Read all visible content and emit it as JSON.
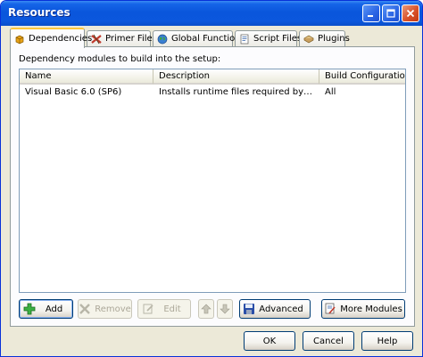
{
  "window": {
    "title": "Resources"
  },
  "tabs": [
    {
      "label": "Dependencies",
      "icon": "dependencies-icon",
      "active": true
    },
    {
      "label": "Primer Files",
      "icon": "primer-files-icon",
      "active": false
    },
    {
      "label": "Global Functions",
      "icon": "globe-icon",
      "active": false
    },
    {
      "label": "Script Files",
      "icon": "script-files-icon",
      "active": false
    },
    {
      "label": "Plugins",
      "icon": "plugins-icon",
      "active": false
    }
  ],
  "panel": {
    "hint": "Dependency modules to build into the setup:"
  },
  "listview": {
    "columns": [
      "Name",
      "Description",
      "Build Configurations"
    ],
    "rows": [
      {
        "name": "Visual Basic 6.0 (SP6)",
        "description": "Installs runtime files required by Visual Basic...",
        "build": "All"
      }
    ]
  },
  "actions": {
    "add": "Add",
    "remove": "Remove",
    "edit": "Edit",
    "advanced": "Advanced",
    "more_modules": "More Modules"
  },
  "footer": {
    "ok": "OK",
    "cancel": "Cancel",
    "help": "Help"
  },
  "colors": {
    "titlebar": "#0a56dc",
    "active_tab_accent": "#ffc83c",
    "button_border": "#003c74"
  }
}
